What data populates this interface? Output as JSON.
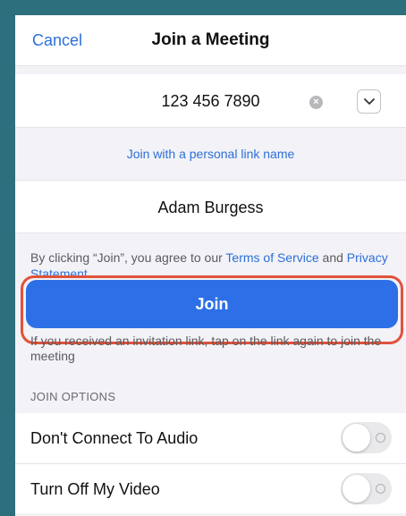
{
  "nav": {
    "cancel_label": "Cancel",
    "title": "Join a Meeting"
  },
  "meeting": {
    "id_value": "123 456 7890",
    "clear_icon": "×",
    "dropdown_icon": "chevron-down-icon"
  },
  "personal_link_label": "Join with a personal link name",
  "name_value": "Adam Burgess",
  "terms": {
    "prefix": "By clicking “Join”, you agree to our ",
    "terms_link": "Terms of Service",
    "middle": " and ",
    "privacy_link": "Privacy Statement"
  },
  "join_label": "Join",
  "invite_note": "If you received an invitation link, tap on the link again to join the meeting",
  "options": {
    "header": "JOIN OPTIONS",
    "items": [
      {
        "label": "Don't Connect To Audio",
        "enabled": false
      },
      {
        "label": "Turn Off My Video",
        "enabled": false
      }
    ]
  },
  "colors": {
    "accent": "#2d6fd8",
    "join_button": "#2d6fe6",
    "highlight": "#e0523a",
    "background": "#2e6f7d"
  }
}
